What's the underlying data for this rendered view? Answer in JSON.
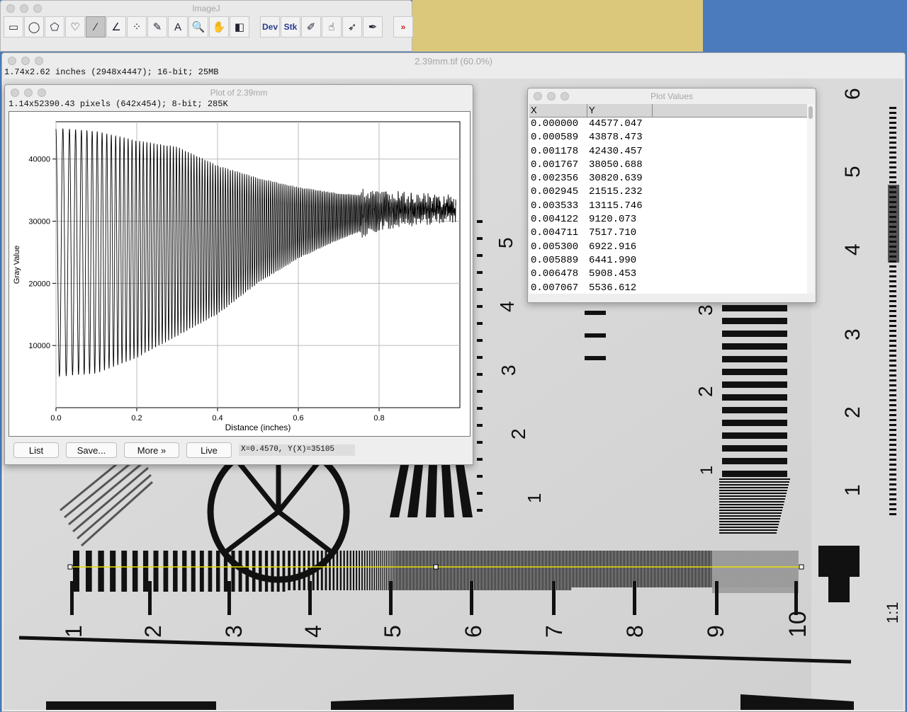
{
  "imagej": {
    "title": "ImageJ",
    "tools": [
      {
        "name": "rectangle-tool",
        "glyph": "▭"
      },
      {
        "name": "oval-tool",
        "glyph": "◯"
      },
      {
        "name": "polygon-tool",
        "glyph": "⬠"
      },
      {
        "name": "freehand-tool",
        "glyph": "♡"
      },
      {
        "name": "line-tool",
        "glyph": "∕"
      },
      {
        "name": "angle-tool",
        "glyph": "∠"
      },
      {
        "name": "point-tool",
        "glyph": "⁘"
      },
      {
        "name": "wand-tool",
        "glyph": "✎"
      },
      {
        "name": "text-tool",
        "glyph": "A"
      },
      {
        "name": "zoom-tool",
        "glyph": "🔍"
      },
      {
        "name": "hand-tool",
        "glyph": "✋"
      },
      {
        "name": "color-picker-tool",
        "glyph": "◧"
      },
      {
        "name": "dev-menu",
        "label": "Dev"
      },
      {
        "name": "stk-menu",
        "label": "Stk"
      },
      {
        "name": "brush-tool",
        "glyph": "✐"
      },
      {
        "name": "flood-tool",
        "glyph": "☝"
      },
      {
        "name": "arrow-tool",
        "glyph": "➶"
      },
      {
        "name": "pencil-tool",
        "glyph": "✒"
      },
      {
        "name": "more-tools",
        "label": "»"
      }
    ]
  },
  "image_window": {
    "title": "2.39mm.tif (60.0%)",
    "info": "1.74x2.62 inches (2948x4447); 16-bit; 25MB"
  },
  "plot_window": {
    "title": "Plot of 2.39mm",
    "info": "1.14x52390.43 pixels (642x454); 8-bit; 285K",
    "buttons": {
      "list": "List",
      "save": "Save...",
      "more": "More »",
      "live": "Live"
    },
    "coords": "X=0.4570, Y(X)=35105"
  },
  "values_window": {
    "title": "Plot Values",
    "columns": [
      "X",
      "Y"
    ],
    "rows": [
      [
        "0.000000",
        "44577.047"
      ],
      [
        "0.000589",
        "43878.473"
      ],
      [
        "0.001178",
        "42430.457"
      ],
      [
        "0.001767",
        "38050.688"
      ],
      [
        "0.002356",
        "30820.639"
      ],
      [
        "0.002945",
        "21515.232"
      ],
      [
        "0.003533",
        "13115.746"
      ],
      [
        "0.004122",
        "9120.073"
      ],
      [
        "0.004711",
        "7517.710"
      ],
      [
        "0.005300",
        "6922.916"
      ],
      [
        "0.005889",
        "6441.990"
      ],
      [
        "0.006478",
        "5908.453"
      ],
      [
        "0.007067",
        "5536.612"
      ]
    ]
  },
  "chart_data": {
    "type": "line",
    "xlabel": "Distance (inches)",
    "ylabel": "Gray Value",
    "xlim": [
      0,
      1.0
    ],
    "ylim": [
      0,
      46000
    ],
    "x_ticks": [
      "0.0",
      "0.2",
      "0.4",
      "0.6",
      "0.8"
    ],
    "y_ticks": [
      "10000",
      "20000",
      "30000",
      "40000"
    ],
    "grid": true,
    "series_description_points": {
      "x": [
        0.0,
        0.1,
        0.2,
        0.3,
        0.4,
        0.5,
        0.6,
        0.7,
        0.8,
        0.9,
        0.99
      ],
      "upper_envelope": [
        45000,
        44500,
        43000,
        42000,
        39000,
        37000,
        35500,
        34500,
        34000,
        33500,
        33000
      ],
      "lower_envelope": [
        5000,
        5500,
        8000,
        11500,
        15000,
        20000,
        24000,
        27000,
        29500,
        30500,
        31000
      ]
    },
    "line_color": "#000000"
  },
  "target_chart": {
    "labels": [
      "1",
      "2",
      "3",
      "4",
      "5",
      "6",
      "7",
      "8",
      "9",
      "10",
      "1:1",
      "1",
      "2",
      "3",
      "4",
      "5",
      "6",
      "1",
      "2",
      "3",
      "4",
      "5",
      "1",
      "2",
      "3",
      "5"
    ]
  }
}
